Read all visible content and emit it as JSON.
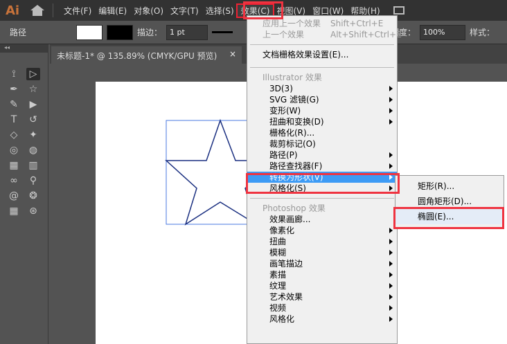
{
  "app": {
    "logo": "Ai"
  },
  "menubar": [
    "文件(F)",
    "编辑(E)",
    "对象(O)",
    "文字(T)",
    "选择(S)",
    "效果(C)",
    "视图(V)",
    "窗口(W)",
    "帮助(H)"
  ],
  "control": {
    "label": "路径",
    "stroke_label": "描边：",
    "stroke_value": "1 pt",
    "opacity_label": "透明度：",
    "opacity_value": "100%",
    "style_label": "样式："
  },
  "tab": {
    "title": "未标题-1* @ 135.89% (CMYK/GPU 预览)",
    "close": "×"
  },
  "effect_menu": {
    "apply_last": "应用上一个效果",
    "apply_last_sc": "Shift+Ctrl+E",
    "last": "上一个效果",
    "last_sc": "Alt+Shift+Ctrl+E",
    "doc_raster": "文档栅格效果设置(E)...",
    "illustrator_header": "Illustrator 效果",
    "illustrator_items": [
      "3D(3)",
      "SVG 滤镜(G)",
      "变形(W)",
      "扭曲和变换(D)",
      "栅格化(R)...",
      "裁剪标记(O)",
      "路径(P)",
      "路径查找器(F)",
      "转换为形状(V)",
      "风格化(S)"
    ],
    "photoshop_header": "Photoshop 效果",
    "photoshop_items": [
      "效果画廊...",
      "像素化",
      "扭曲",
      "模糊",
      "画笔描边",
      "素描",
      "纹理",
      "艺术效果",
      "视频",
      "风格化"
    ]
  },
  "submenu": [
    "矩形(R)...",
    "圆角矩形(D)...",
    "椭圆(E)..."
  ]
}
